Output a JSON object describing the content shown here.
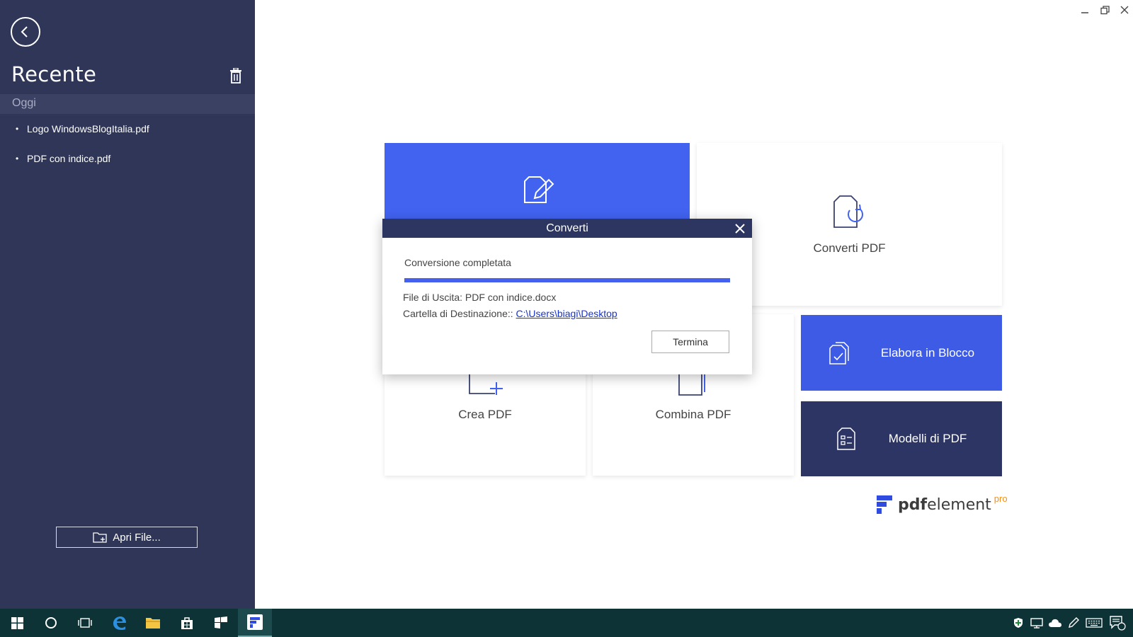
{
  "sidebar": {
    "title": "Recente",
    "section": "Oggi",
    "recent_files": [
      "Logo WindowsBlogItalia.pdf",
      "PDF con indice.pdf"
    ],
    "open_file_label": "Apri File..."
  },
  "tiles": {
    "convert": "Converti PDF",
    "create": "Crea PDF",
    "combine": "Combina PDF",
    "batch": "Elabora in Blocco",
    "templates": "Modelli di PDF"
  },
  "logo": {
    "text_bold": "pdf",
    "text_regular": "element",
    "pro": "pro"
  },
  "dialog": {
    "title": "Converti",
    "status": "Conversione completata",
    "progress_percent": 100,
    "output_label": "File di Uscita: ",
    "output_file": "PDF con indice.docx",
    "dest_label": "Cartella di Destinazione:: ",
    "dest_path": "C:\\Users\\biagi\\Desktop",
    "finish_button": "Termina"
  },
  "colors": {
    "sidebar_bg": "#2f3658",
    "accent_blue": "#4263f0",
    "dark_navy": "#2c3564",
    "taskbar_bg": "#0e3336",
    "logo_pro": "#f19020"
  },
  "icons": {
    "back": "back-arrow-icon",
    "trash": "trash-icon",
    "edit_tile": "edit-document-icon",
    "convert_tile": "convert-document-icon",
    "create_tile": "create-document-icon",
    "combine_tile": "combine-documents-icon",
    "batch_tile": "batch-documents-icon",
    "templates_tile": "templates-icon"
  }
}
